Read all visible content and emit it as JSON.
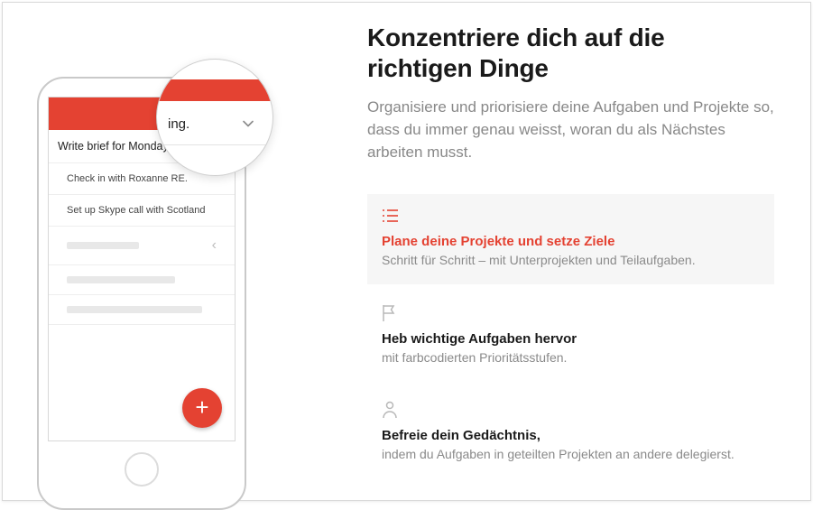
{
  "colors": {
    "accent": "#e44232"
  },
  "headline": "Konzentriere dich auf die richtigen Dinge",
  "subhead": "Organisiere und priorisiere deine Aufgaben und Projekte so, dass du immer genau weisst, woran du als Nächstes arbeiten musst.",
  "phone": {
    "tasks": [
      "Write brief for Monday's meeting.",
      "Check in with Roxanne RE.",
      "Set up Skype call with Scotland"
    ],
    "magnifier_fragment": "ing.",
    "fab_label": "+"
  },
  "features": [
    {
      "icon": "list-icon",
      "title": "Plane deine Projekte und setze Ziele",
      "desc": "Schritt für Schritt – mit Unterprojekten und Teilaufgaben.",
      "active": true
    },
    {
      "icon": "flag-icon",
      "title": "Heb wichtige Aufgaben hervor",
      "desc": "mit farbcodierten Prioritätsstufen.",
      "active": false
    },
    {
      "icon": "person-icon",
      "title": "Befreie dein Gedächtnis,",
      "desc": "indem du Aufgaben in geteilten Projekten an andere delegierst.",
      "active": false
    }
  ]
}
